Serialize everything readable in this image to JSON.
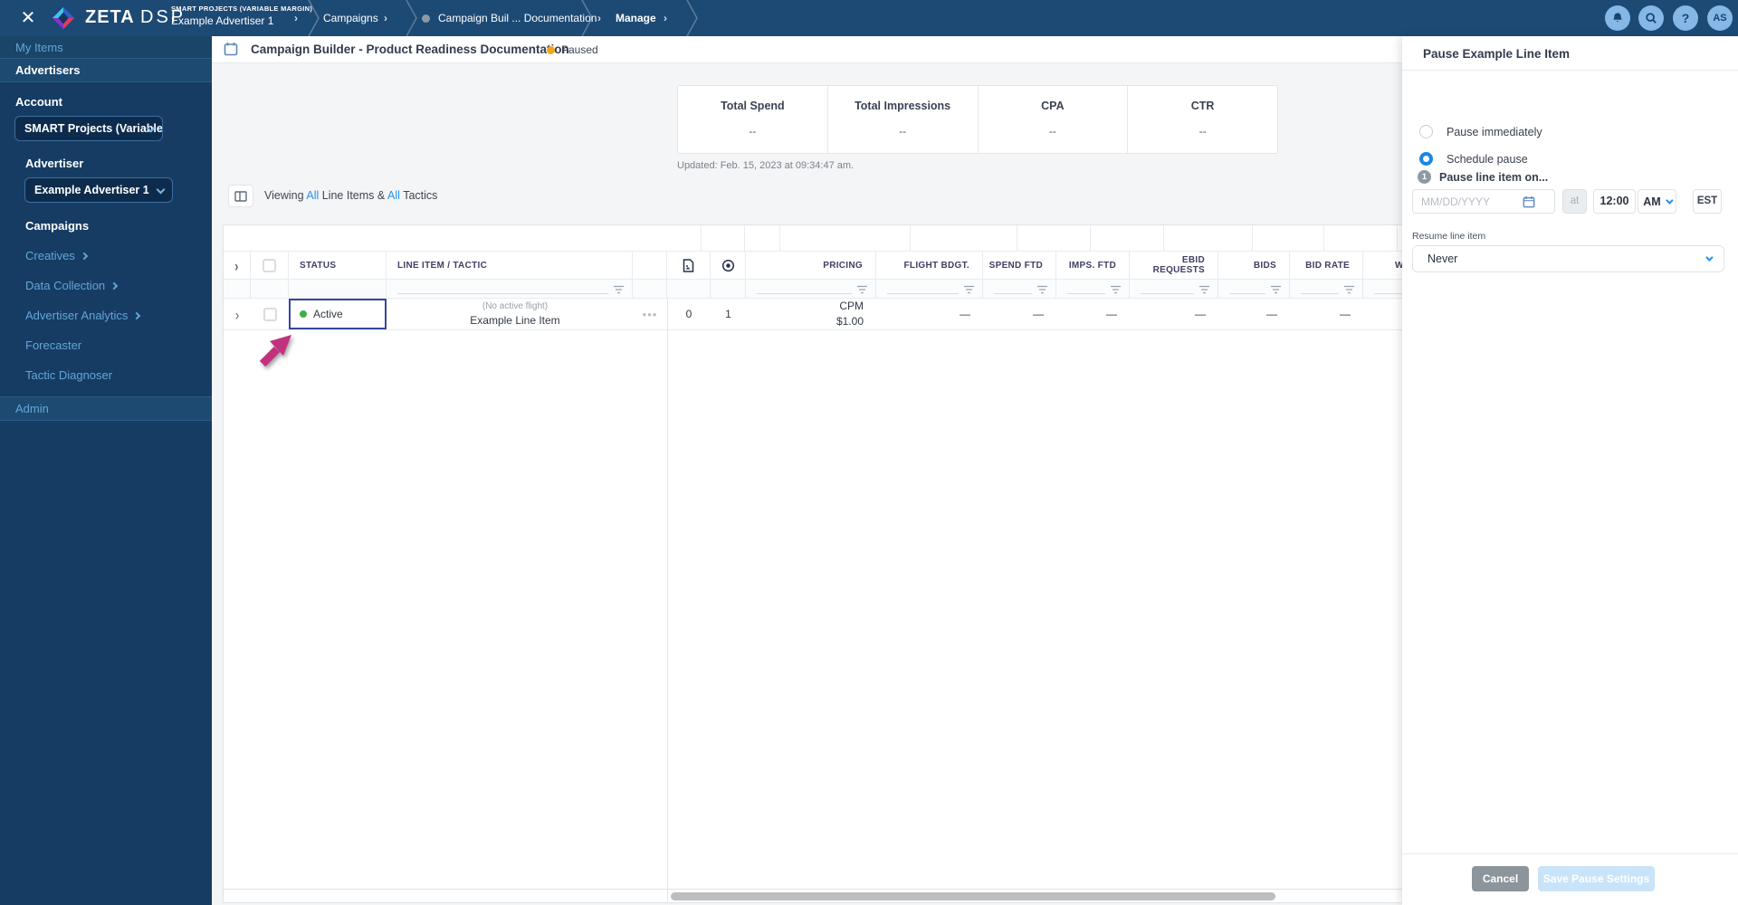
{
  "topbar": {
    "logo": {
      "zeta": "ZETA",
      "dsp": "DSP"
    },
    "close": "✕",
    "breadcrumb": {
      "account": "SMART PROJECTS (VARIABLE MARGIN)",
      "advertiser": "Example Advertiser 1",
      "campaigns": "Campaigns",
      "campaign": "Campaign Buil ... Documentation",
      "manage": "Manage",
      "chevron": "›"
    },
    "help": "?",
    "avatar": "AS"
  },
  "sidebar": {
    "my_items": "My Items",
    "advertisers": "Advertisers",
    "account_label": "Account",
    "account_value": "SMART Projects (Variable M",
    "advertiser_label": "Advertiser",
    "advertiser_value": "Example Advertiser 1",
    "campaigns": "Campaigns",
    "creatives": "Creatives",
    "data_collection": "Data Collection",
    "advertiser_analytics": "Advertiser Analytics",
    "forecaster": "Forecaster",
    "tactic_diagnoser": "Tactic Diagnoser",
    "admin": "Admin"
  },
  "header": {
    "title": "Campaign Builder - Product Readiness Documentation",
    "status": "Paused"
  },
  "stats": {
    "metrics": [
      {
        "label": "Total Spend",
        "value": "--"
      },
      {
        "label": "Total Impressions",
        "value": "--"
      },
      {
        "label": "CPA",
        "value": "--"
      },
      {
        "label": "CTR",
        "value": "--"
      }
    ],
    "updated": "Updated: Feb. 15, 2023 at 09:34:47 am."
  },
  "viewing": {
    "prefix": "Viewing",
    "all_line_items": "All",
    "middle": "Line Items &",
    "all_tactics": "All",
    "suffix": "Tactics"
  },
  "table": {
    "headers": {
      "status": "STATUS",
      "line_item": "LINE ITEM / TACTIC",
      "pricing": "PRICING",
      "flight_bdgt": "FLIGHT BDGT.",
      "spend_ftd": "SPEND FTD",
      "imps_ftd": "IMPS. FTD",
      "ebid_requests": "EBID REQUESTS",
      "bids": "BIDS",
      "bid_rate": "BID RATE",
      "wins": "W"
    },
    "expander": "›",
    "row": {
      "status": "Active",
      "flight_note": "(No active flight)",
      "name": "Example Line Item",
      "actions": "•••",
      "creatives_count": "0",
      "tactics_count": "1",
      "pricing_model": "CPM",
      "pricing_value": "$1.00",
      "flight_bdgt": "—",
      "spend_ftd": "—",
      "imps_ftd": "—",
      "ebid_requests": "—",
      "bids": "—",
      "bid_rate": "—"
    }
  },
  "panel": {
    "title": "Pause Example Line Item",
    "pause_immediately": "Pause immediately",
    "schedule_pause": "Schedule pause",
    "step": "1",
    "pause_on_label": "Pause line item on...",
    "date_placeholder": "MM/DD/YYYY",
    "at_label": "at",
    "time_value": "12:00",
    "meridiem": "AM",
    "timezone": "EST",
    "resume_label": "Resume line item",
    "resume_value": "Never",
    "cancel": "Cancel",
    "save": "Save Pause Settings"
  },
  "colors": {
    "topbar_blue": "#1d4a75",
    "sidebar_navy": "#163c63",
    "accent_blue": "#2792e8",
    "active_green": "#3fae49",
    "paused_orange": "#f5a41d",
    "selected_cell_border": "#3647a5",
    "arrow_pink": "#c2327c"
  }
}
